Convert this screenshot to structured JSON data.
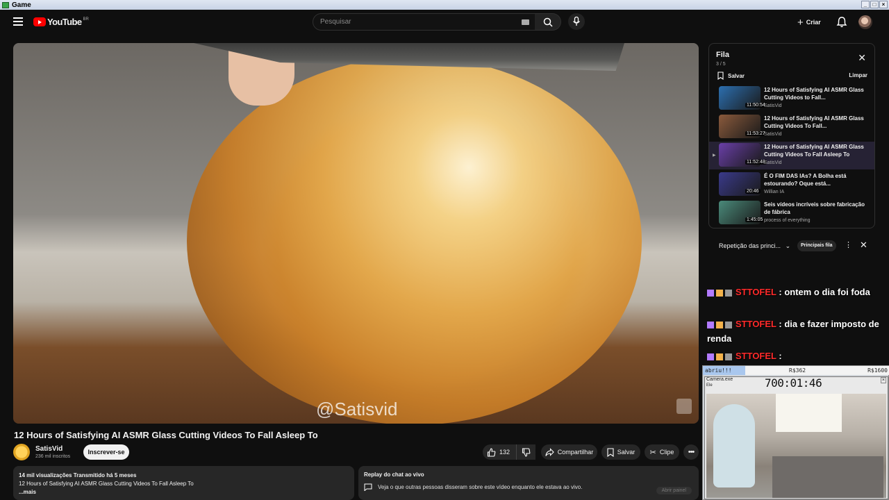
{
  "window": {
    "title": "Game"
  },
  "topbar": {
    "logo_word": "YouTube",
    "country": "BR",
    "search_placeholder": "Pesquisar",
    "create_label": "Criar"
  },
  "player": {
    "watermark": "@Satisvid"
  },
  "video": {
    "title": "12 Hours of Satisfying AI ASMR Glass Cutting Videos To Fall Asleep To",
    "channel": "SatisVid",
    "subscribers": "236 mil inscritos",
    "subscribe_label": "Inscrever-se",
    "likes": "132",
    "share_label": "Compartilhar",
    "save_label": "Salvar",
    "clip_label": "Clipe"
  },
  "description": {
    "stats": "14 mil visualizações  Transmitido há 5 meses",
    "text": "12 Hours of Satisfying AI ASMR Glass Cutting Videos To Fall Asleep To",
    "more": "...mais"
  },
  "chat_replay": {
    "heading": "Replay do chat ao vivo",
    "text": "Veja o que outras pessoas disseram sobre este vídeo enquanto ele estava ao vivo.",
    "open_label": "Abrir painel"
  },
  "queue": {
    "title": "Fila",
    "count": "3 / 5",
    "save_label": "Salvar",
    "clear_label": "Limpar",
    "items": [
      {
        "title": "12 Hours of Satisfying AI ASMR Glass Cutting Videos to Fall...",
        "channel": "SatisVid",
        "duration": "11:50:54",
        "color": "#2c6fb0"
      },
      {
        "title": "12 Hours of Satisfying AI ASMR Glass Cutting Videos To Fall...",
        "channel": "SatisVid",
        "duration": "11:53:27",
        "color": "#8a5a3c"
      },
      {
        "title": "12 Hours of Satisfying AI ASMR Glass Cutting Videos To Fall Asleep To",
        "channel": "SatisVid",
        "duration": "11:52:48",
        "color": "#6a3fa8",
        "marker": "▶"
      },
      {
        "title": "É O FIM DAS IAs? A Bolha está estourando? Oque está...",
        "channel": "Willian IA",
        "duration": "20:46",
        "color": "#3a3a8a"
      },
      {
        "title": "Seis vídeos incríveis sobre fabricação de fábrica",
        "channel": "process of everything",
        "duration": "1:45:05",
        "color": "#4a8a7a"
      }
    ]
  },
  "chat_header": {
    "label": "Repetição das princi...",
    "badge": "Principais fila"
  },
  "overlay_chat": [
    {
      "user": "STTOFEL",
      "text": "ontem o dia foi foda"
    },
    {
      "user": "STTOFEL",
      "text": "dia e fazer imposto de renda"
    },
    {
      "user": "STTOFEL",
      "text": ""
    }
  ],
  "stream_overlay": {
    "goal_label": "abriu!!!",
    "goal_mid": "R$362",
    "goal_target": "R$1600",
    "goal_progress": 0.226,
    "cam_title": "Camera.exe",
    "cam_menu": "Ele",
    "timer": "700:01:46"
  }
}
